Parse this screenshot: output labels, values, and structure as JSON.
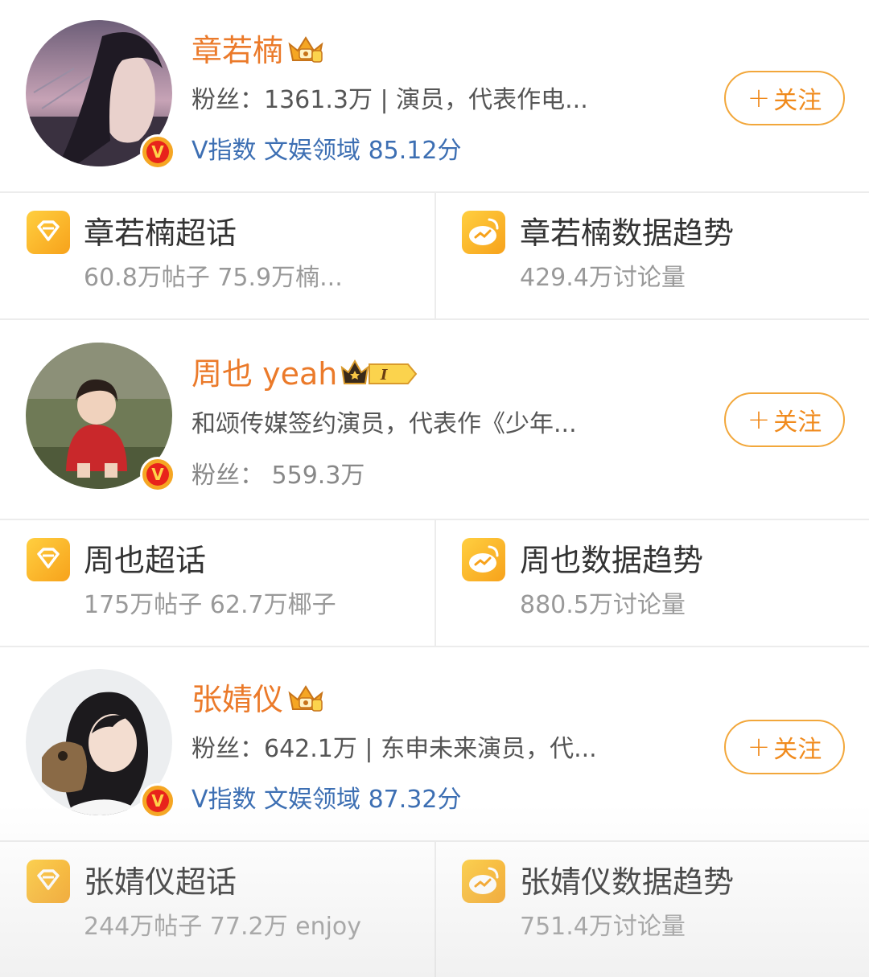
{
  "accounts": [
    {
      "name": "章若楠",
      "info": "粉丝：1361.3万 | 演员，代表作电...",
      "third_line": "V指数 文娱领域 85.12分",
      "third_line_type": "vindex",
      "follow_label": "关注",
      "follow_plus": "+",
      "crown_type": "crown-icon",
      "supertopic": {
        "title": "章若楠超话",
        "subtitle": "60.8万帖子  75.9万楠..."
      },
      "trend": {
        "title": "章若楠数据趋势",
        "subtitle": "429.4万讨论量"
      }
    },
    {
      "name": "周也 yeah",
      "info": "和颂传媒签约演员，代表作《少年...",
      "third_line": "粉丝：  559.3万",
      "third_line_type": "fans",
      "follow_label": "关注",
      "follow_plus": "+",
      "crown_type": "crown-level-badge-icon",
      "crown_level": "I",
      "supertopic": {
        "title": "周也超话",
        "subtitle": "175万帖子  62.7万椰子"
      },
      "trend": {
        "title": "周也数据趋势",
        "subtitle": "880.5万讨论量"
      }
    },
    {
      "name": "张婧仪",
      "info": "粉丝：642.1万 | 东申未来演员，代...",
      "third_line": "V指数 文娱领域 87.32分",
      "third_line_type": "vindex",
      "follow_label": "关注",
      "follow_plus": "+",
      "crown_type": "crown-icon",
      "supertopic": {
        "title": "张婧仪超话",
        "subtitle": "244万帖子  77.2万 enjoy"
      },
      "trend": {
        "title": "张婧仪数据趋势",
        "subtitle": "751.4万讨论量"
      }
    }
  ],
  "colors": {
    "name_orange": "#eb7a2a",
    "vindex_blue": "#3d6fb3",
    "follow_orange": "#f08a1c",
    "icon_yellow": "#f7a21b"
  },
  "verified_badge_glyph": "V"
}
